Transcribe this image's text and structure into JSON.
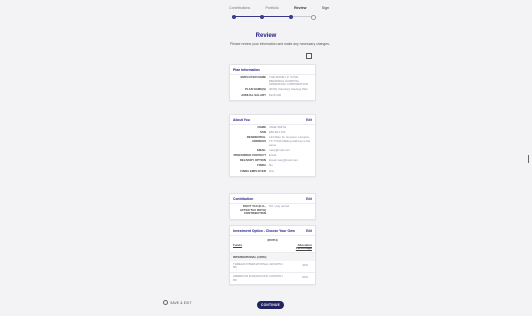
{
  "stepper": {
    "steps": [
      "Contributions",
      "Portfolio",
      "Review",
      "Sign"
    ]
  },
  "header": {
    "title": "Review",
    "subtitle": "Please review your information and make any necessary changes.",
    "print_label": "Print"
  },
  "plan": {
    "title": "Plan Information",
    "rows": [
      {
        "label": "EMPLOYER NAME",
        "value": "THE MONEY P. COVE MEMORIAL HOSPITAL OPERATING CORPORATION"
      },
      {
        "label": "PLAN NAME(S)",
        "value": "403(b) Voluntary Savings Plan"
      },
      {
        "label": "ANNUAL SALARY",
        "value": "$125,000"
      }
    ]
  },
  "about": {
    "title": "About You",
    "edit": "Edit",
    "rows": [
      {
        "label": "NAME",
        "value": "JANE SMITH"
      },
      {
        "label": "SSN",
        "value": "###-##-1732"
      },
      {
        "label": "RESIDENTIAL ADDRESS",
        "value": "123 Main St. Houston, Houston, TX 77010 Mailing address is the same"
      },
      {
        "label": "EMAIL",
        "value": "mary@mail.com"
      },
      {
        "label": "PREFERRED CONTACT",
        "value": "Email"
      },
      {
        "label": "DELIVERY OPTION",
        "value": "Email mary@mail.com"
      },
      {
        "label": "FINRA",
        "value": "No"
      },
      {
        "label": "FINRA EMPLOYER",
        "value": "N/A"
      }
    ]
  },
  "contribution": {
    "title": "Contribution",
    "edit": "Edit",
    "rows": [
      {
        "label": "ROOT TAX (E.G., AFTER TAX ROTH) CONTRIBUTION",
        "value": "5% / pay period"
      }
    ]
  },
  "investment": {
    "title": "Investment Option - Choose Your Own",
    "edit": "Edit",
    "subheader": "(ROTH)",
    "col_funds": "Funds",
    "col_alloc": "Allocation Percentage",
    "category": "INTERNATIONAL (100%)",
    "funds": [
      {
        "name": "THREAD INTERNATIONAL GROWTH R6",
        "pct": "40%"
      },
      {
        "name": "AMERICAN EUROPACIFIC GROWTH R6",
        "pct": "60%"
      }
    ]
  },
  "footer": {
    "save_label": "SAVE & EXIT",
    "continue_label": "CONTINUE"
  }
}
